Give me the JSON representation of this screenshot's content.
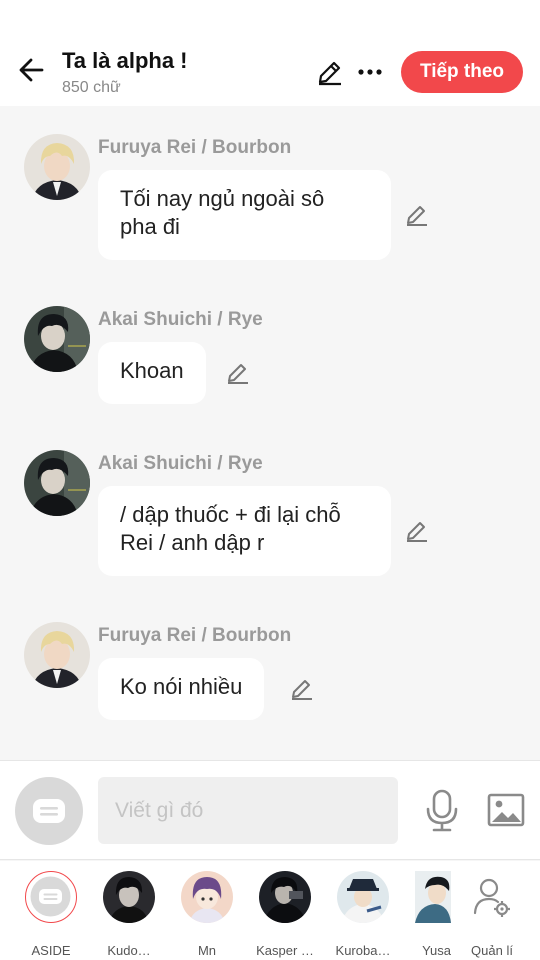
{
  "header": {
    "title": "Ta là alpha !",
    "subtitle": "850 chữ",
    "next_label": "Tiếp theo"
  },
  "messages": [
    {
      "sender": "Furuya Rei / Bourbon",
      "avatar": "furuya-rei",
      "text_lines": [
        "Tối nay ngủ ngoài sô",
        "pha đi"
      ]
    },
    {
      "sender": "Akai Shuichi / Rye",
      "avatar": "akai-shuichi",
      "text_lines": [
        "Khoan"
      ]
    },
    {
      "sender": "Akai Shuichi / Rye",
      "avatar": "akai-shuichi",
      "text_lines": [
        "/ dập thuốc + đi lại chỗ",
        "Rei / anh dập r"
      ]
    },
    {
      "sender": "Furuya Rei / Bourbon",
      "avatar": "furuya-rei",
      "text_lines": [
        "Ko nói nhiều"
      ]
    }
  ],
  "composer": {
    "placeholder": "Viết gì đó",
    "value": ""
  },
  "characters": [
    {
      "label": "ASIDE",
      "icon": "aside-icon",
      "selected": true
    },
    {
      "label": "Kudo…",
      "icon": "kudo-avatar"
    },
    {
      "label": "Mn",
      "icon": "mn-avatar"
    },
    {
      "label": "Kasper …",
      "icon": "kasper-avatar"
    },
    {
      "label": "Kuroba…",
      "icon": "kuroba-avatar"
    },
    {
      "label": "Yusa",
      "icon": "yusa-avatar"
    },
    {
      "label": "Quản lí",
      "icon": "manage-icon"
    }
  ],
  "colors": {
    "accent": "#f2484b",
    "background": "#f6f6f6",
    "sender_text": "#9a9a9a",
    "bubble": "#ffffff"
  }
}
